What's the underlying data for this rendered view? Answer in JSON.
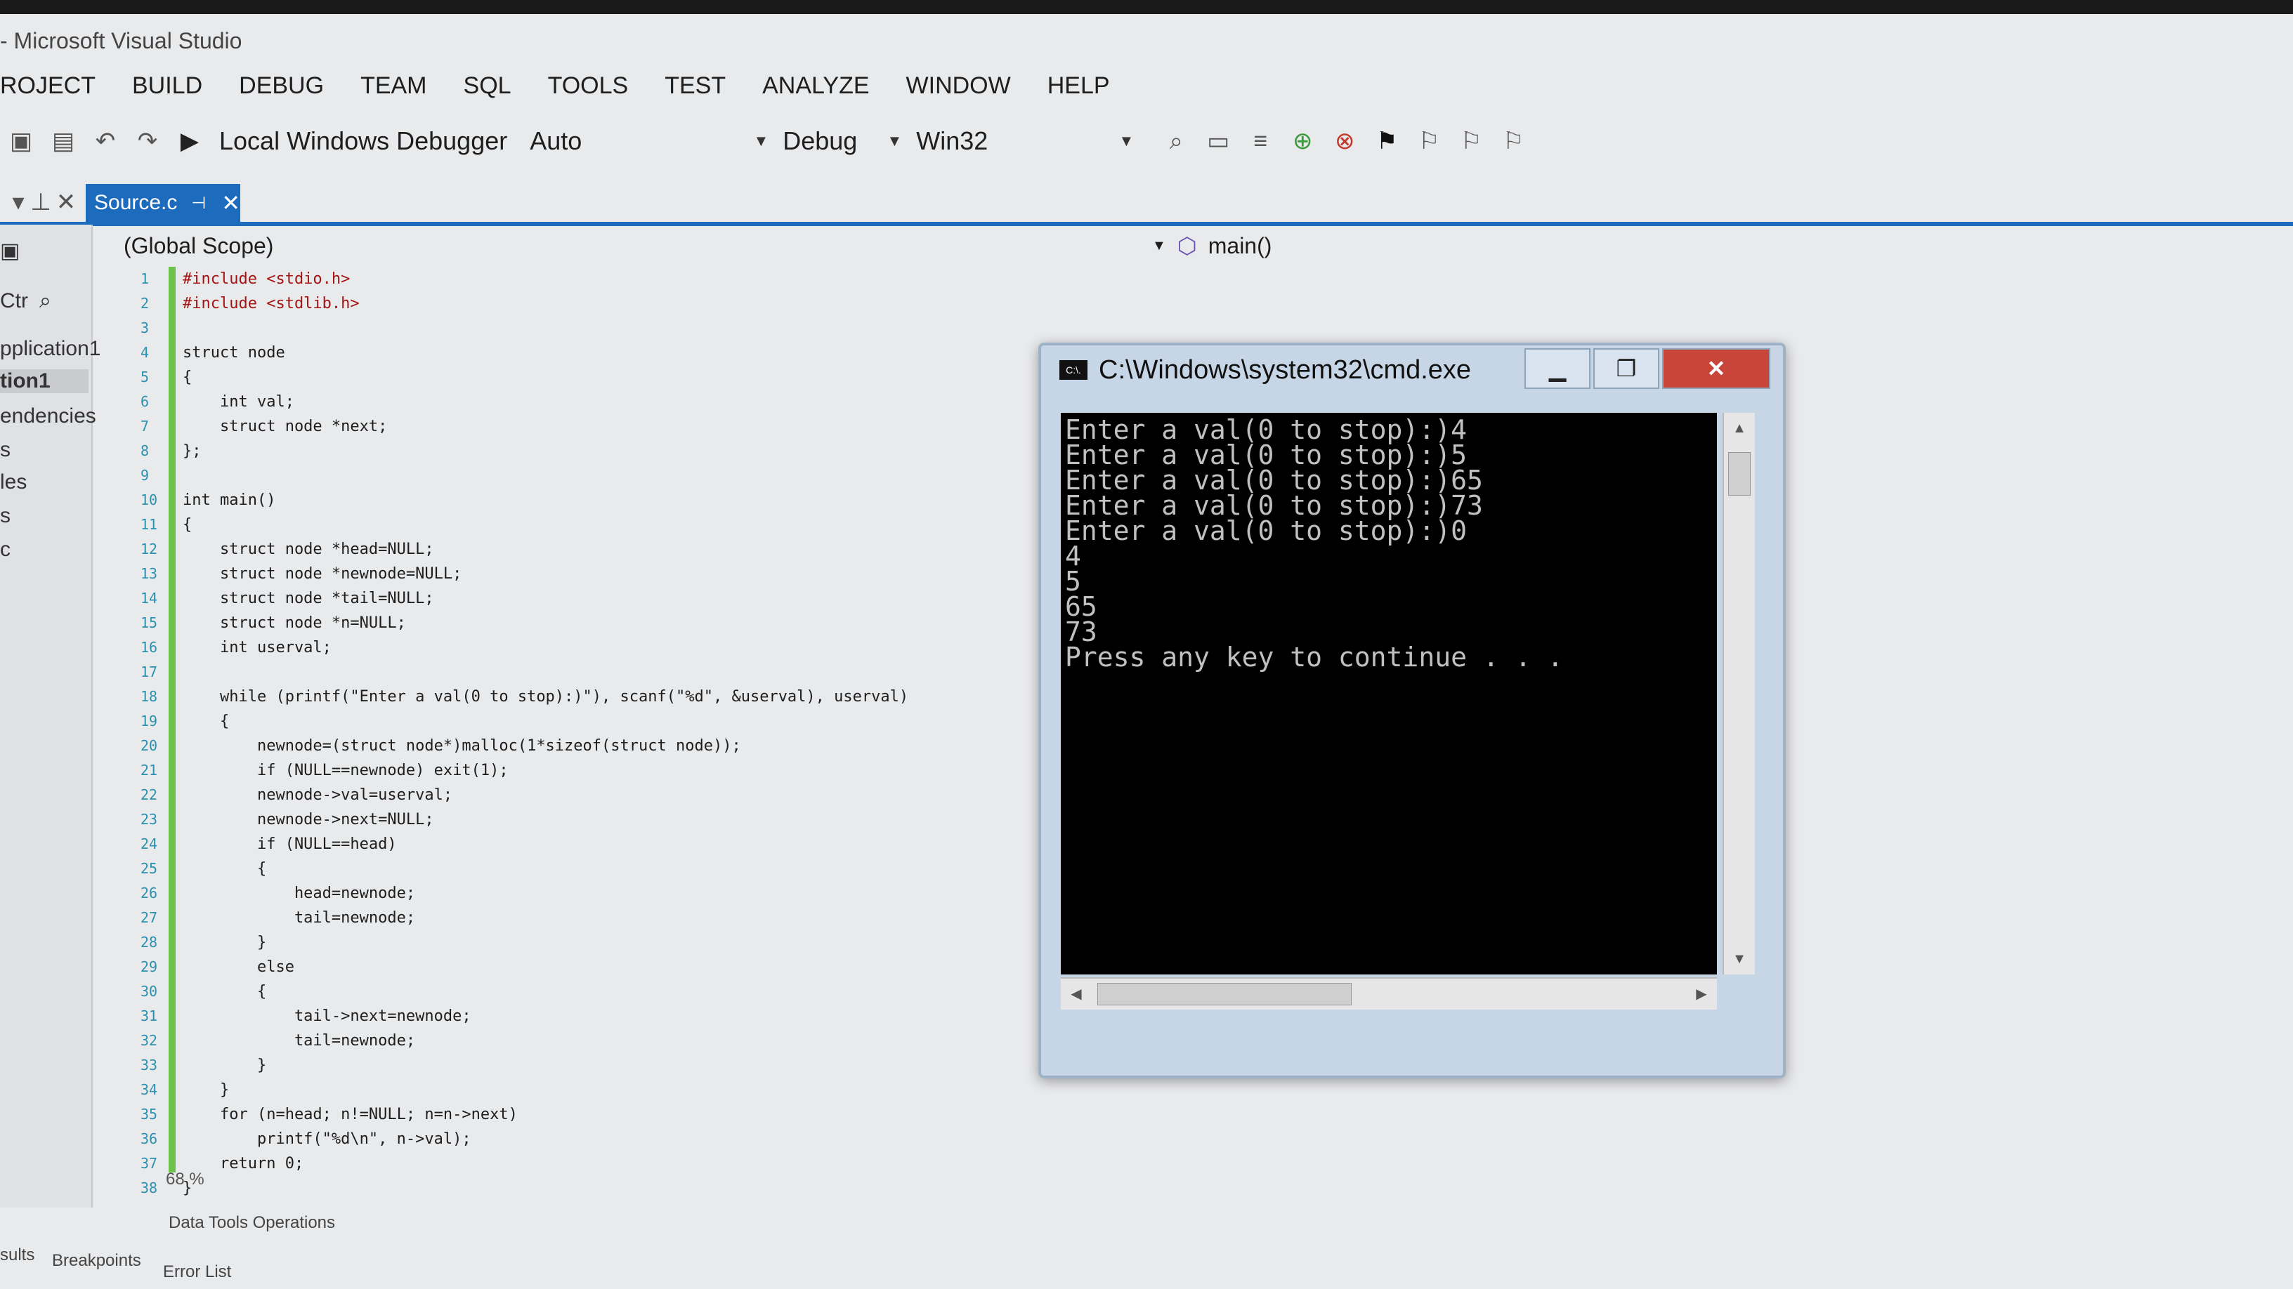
{
  "window": {
    "title": "- Microsoft Visual Studio"
  },
  "menu": [
    "ROJECT",
    "BUILD",
    "DEBUG",
    "TEAM",
    "SQL",
    "TOOLS",
    "TEST",
    "ANALYZE",
    "WINDOW",
    "HELP"
  ],
  "toolbar": {
    "debugger_label": "Local Windows Debugger",
    "solution_platform_auto": "Auto",
    "configuration": "Debug",
    "platform": "Win32"
  },
  "tabs": {
    "active_tab": "Source.c"
  },
  "side_panel": {
    "search_label": "Ctr",
    "items": [
      "pplication1",
      "tion1",
      "endencies",
      "s",
      "les",
      "s",
      "c"
    ]
  },
  "scope_bar": {
    "left": "(Global Scope)",
    "right": "main()"
  },
  "editor": {
    "line_numbers": [
      "1",
      "2",
      "3",
      "4",
      "5",
      "6",
      "7",
      "8",
      "9",
      "10",
      "11",
      "12",
      "13",
      "14",
      "15",
      "16",
      "17",
      "18",
      "19",
      "20",
      "21",
      "22",
      "23",
      "24",
      "25",
      "26",
      "27",
      "28",
      "29",
      "30",
      "31",
      "32",
      "33",
      "34",
      "35",
      "36",
      "37",
      "38"
    ],
    "lines": [
      "#include <stdio.h>",
      "#include <stdlib.h>",
      "",
      "struct node",
      "{",
      "    int val;",
      "    struct node *next;",
      "};",
      "",
      "int main()",
      "{",
      "    struct node *head=NULL;",
      "    struct node *newnode=NULL;",
      "    struct node *tail=NULL;",
      "    struct node *n=NULL;",
      "    int userval;",
      "",
      "    while (printf(\"Enter a val(0 to stop):)\"), scanf(\"%d\", &userval), userval)",
      "    {",
      "        newnode=(struct node*)malloc(1*sizeof(struct node));",
      "        if (NULL==newnode) exit(1);",
      "        newnode->val=userval;",
      "        newnode->next=NULL;",
      "        if (NULL==head)",
      "        {",
      "            head=newnode;",
      "            tail=newnode;",
      "        }",
      "        else",
      "        {",
      "            tail->next=newnode;",
      "            tail=newnode;",
      "        }",
      "    }",
      "    for (n=head; n!=NULL; n=n->next)",
      "        printf(\"%d\\n\", n->val);",
      "    return 0;",
      "}"
    ],
    "zoom": "68 %"
  },
  "bottom_panel": {
    "data_tools": "Data Tools Operations",
    "tabs": [
      "sults",
      "Breakpoints",
      "Error List"
    ]
  },
  "console": {
    "title": "C:\\Windows\\system32\\cmd.exe",
    "icon_label": "C:\\.",
    "output": "Enter a val(0 to stop):)4\nEnter a val(0 to stop):)5\nEnter a val(0 to stop):)65\nEnter a val(0 to stop):)73\nEnter a val(0 to stop):)0\n4\n5\n65\n73\nPress any key to continue . . ."
  },
  "colors": {
    "accent": "#1c6bbd",
    "console_bg": "#000000",
    "console_fg": "#c0c0c0",
    "close_button": "#c8453a",
    "keyword": "#0000ff",
    "string": "#a31515",
    "type": "#2b91af"
  },
  "icons": [
    "save-icon",
    "undo-icon",
    "redo-icon",
    "play-icon",
    "bookmark-icon",
    "pin-icon",
    "close-icon",
    "search-icon",
    "function-icon",
    "cmd-icon",
    "minimize-icon",
    "maximize-icon"
  ]
}
